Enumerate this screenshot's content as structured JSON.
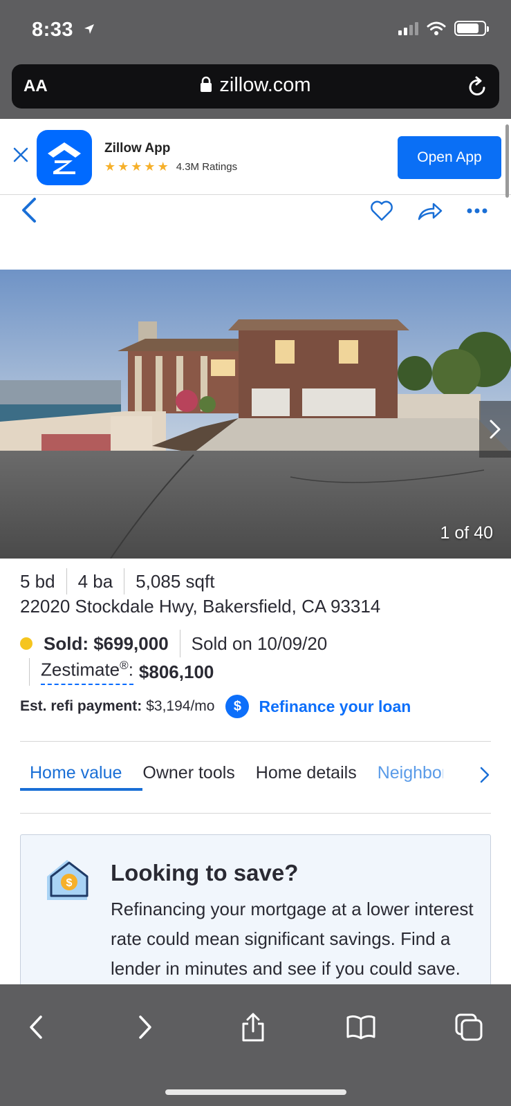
{
  "status_bar": {
    "time": "8:33"
  },
  "browser": {
    "aa_label": "AA",
    "url": "zillow.com"
  },
  "app_banner": {
    "app_name": "Zillow App",
    "rating_text": "4.3M Ratings",
    "stars": 5,
    "open_label": "Open App"
  },
  "photo": {
    "counter": "1 of 40"
  },
  "listing": {
    "beds": "5 bd",
    "baths": "4 ba",
    "sqft": "5,085 sqft",
    "address": "22020 Stockdale Hwy, Bakersfield, CA 93314",
    "sold_price": "Sold: $699,000",
    "sold_date": "Sold on 10/09/20",
    "zestimate_label": "Zestimate",
    "zestimate_reg": "®",
    "zestimate_colon": ":",
    "zestimate_value": "$806,100",
    "refi_label": "Est. refi payment:",
    "refi_value": "$3,194/mo",
    "refi_icon": "$",
    "refi_link": "Refinance your loan"
  },
  "tabs": [
    {
      "label": "Home value",
      "active": true
    },
    {
      "label": "Owner tools"
    },
    {
      "label": "Home details"
    },
    {
      "label": "Neighborhood"
    }
  ],
  "save_card": {
    "title": "Looking to save?",
    "body": "Refinancing your mortgage at a lower interest rate could mean significant savings. Find a lender in minutes and see if you could save."
  },
  "colors": {
    "accent": "#006aff",
    "link": "#1a6fd6",
    "sold_dot": "#f5c51e",
    "chrome": "#5e5e60"
  }
}
